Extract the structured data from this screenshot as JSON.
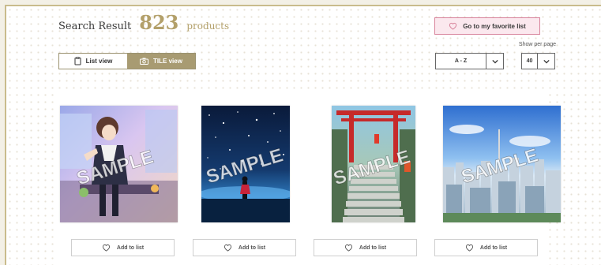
{
  "header": {
    "label": "Search Result",
    "count": "823",
    "unit": "products",
    "favorite_label": "Go to my favorite list",
    "per_page_label": "Show per page"
  },
  "view_toggle": {
    "list_label": "List view",
    "tile_label": "TILE view",
    "active": "tile"
  },
  "sort": {
    "value": "A - Z"
  },
  "per_page": {
    "value": "40"
  },
  "products": [
    {
      "thumb": "anime-girl-classroom-image",
      "watermark": "SAMPLE",
      "add_label": "Add to list"
    },
    {
      "thumb": "starry-night-figure-image",
      "watermark": "SAMPLE",
      "add_label": "Add to list"
    },
    {
      "thumb": "torii-gate-stairs-image",
      "watermark": "SAMPLE",
      "add_label": "Add to list"
    },
    {
      "thumb": "city-skyline-image",
      "watermark": "SAMPLE",
      "add_label": "Add to list"
    }
  ],
  "colors": {
    "accent_gold": "#b3a06a",
    "tile_active": "#a89b72",
    "favorite_border": "#d8849c",
    "favorite_bg": "#fbe8ee"
  }
}
